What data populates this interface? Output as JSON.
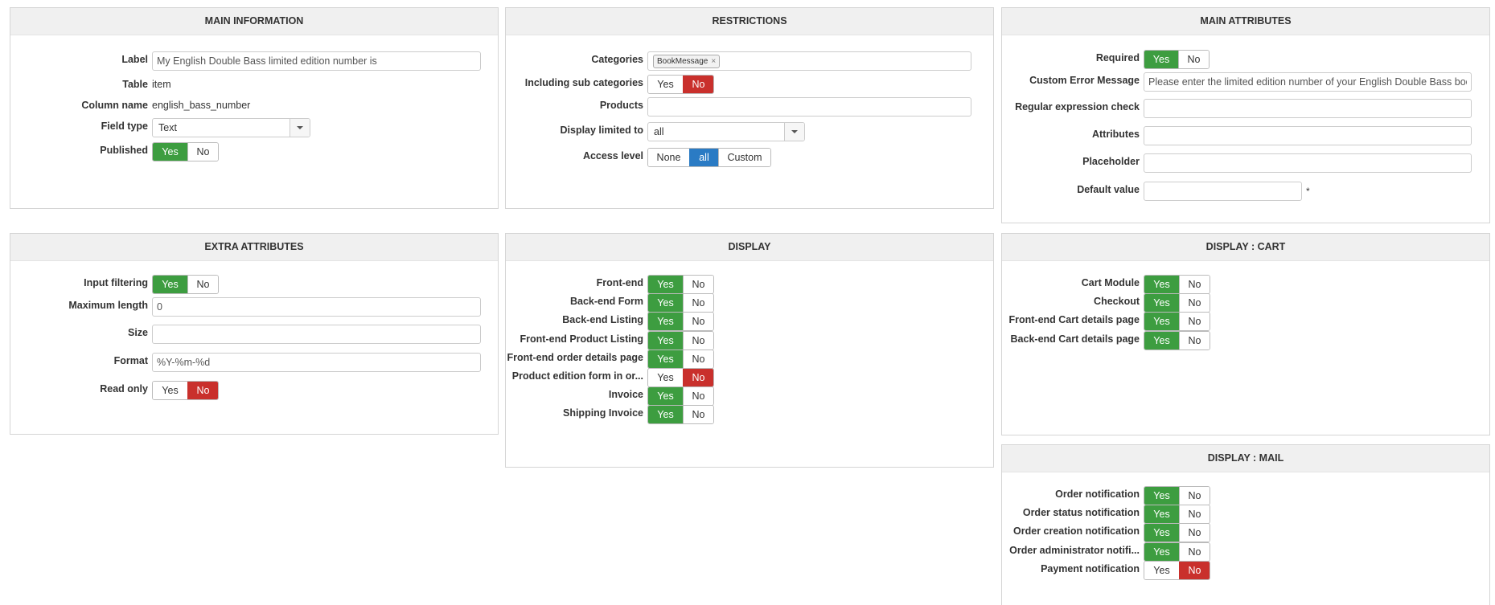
{
  "main_information": {
    "title": "MAIN INFORMATION",
    "label_label": "Label",
    "label_value": "My English Double Bass limited edition number is",
    "table_label": "Table",
    "table_value": "item",
    "column_label": "Column name",
    "column_value": "english_bass_number",
    "fieldtype_label": "Field type",
    "fieldtype_value": "Text",
    "published_label": "Published",
    "published_yes": "Yes",
    "published_no": "No"
  },
  "restrictions": {
    "title": "RESTRICTIONS",
    "categories_label": "Categories",
    "category_tag": "BookMessage",
    "tag_remove": "×",
    "subcat_label": "Including sub categories",
    "subcat_yes": "Yes",
    "subcat_no": "No",
    "products_label": "Products",
    "products_value": "",
    "display_limited_label": "Display limited to",
    "display_limited_value": "all",
    "access_label": "Access level",
    "access_none": "None",
    "access_all": "all",
    "access_custom": "Custom"
  },
  "main_attributes": {
    "title": "MAIN ATTRIBUTES",
    "required_label": "Required",
    "required_yes": "Yes",
    "required_no": "No",
    "custom_error_label": "Custom Error Message",
    "custom_error_value": "Please enter the limited edition number of your English Double Bass book",
    "regex_label": "Regular expression check",
    "regex_value": "",
    "attributes_label": "Attributes",
    "attributes_value": "",
    "placeholder_label": "Placeholder",
    "placeholder_value": "",
    "default_label": "Default value",
    "default_value": "",
    "default_marker": "*"
  },
  "extra_attributes": {
    "title": "EXTRA ATTRIBUTES",
    "input_filtering_label": "Input filtering",
    "input_filtering_yes": "Yes",
    "input_filtering_no": "No",
    "maxlength_label": "Maximum length",
    "maxlength_value": "0",
    "size_label": "Size",
    "size_value": "",
    "format_label": "Format",
    "format_value": "%Y-%m-%d",
    "readonly_label": "Read only",
    "readonly_yes": "Yes",
    "readonly_no": "No"
  },
  "display": {
    "title": "DISPLAY",
    "yes": "Yes",
    "no": "No",
    "rows": [
      {
        "label": "Front-end",
        "value": "yes"
      },
      {
        "label": "Back-end Form",
        "value": "yes"
      },
      {
        "label": "Back-end Listing",
        "value": "yes"
      },
      {
        "label": "Front-end Product Listing",
        "value": "yes"
      },
      {
        "label": "Front-end order details page",
        "value": "yes"
      },
      {
        "label": "Product edition form in or...",
        "value": "no"
      },
      {
        "label": "Invoice",
        "value": "yes"
      },
      {
        "label": "Shipping Invoice",
        "value": "yes"
      }
    ]
  },
  "display_cart": {
    "title": "DISPLAY : CART",
    "yes": "Yes",
    "no": "No",
    "rows": [
      {
        "label": "Cart Module",
        "value": "yes"
      },
      {
        "label": "Checkout",
        "value": "yes"
      },
      {
        "label": "Front-end Cart details page",
        "value": "yes"
      },
      {
        "label": "Back-end Cart details page",
        "value": "yes"
      }
    ]
  },
  "display_mail": {
    "title": "DISPLAY : MAIL",
    "yes": "Yes",
    "no": "No",
    "rows": [
      {
        "label": "Order notification",
        "value": "yes"
      },
      {
        "label": "Order status notification",
        "value": "yes"
      },
      {
        "label": "Order creation notification",
        "value": "yes"
      },
      {
        "label": "Order administrator notifi...",
        "value": "yes"
      },
      {
        "label": "Payment notification",
        "value": "no"
      }
    ]
  },
  "colors": {
    "green": "#3d9d40",
    "red": "#c9302c",
    "blue": "#2a7bc4"
  }
}
